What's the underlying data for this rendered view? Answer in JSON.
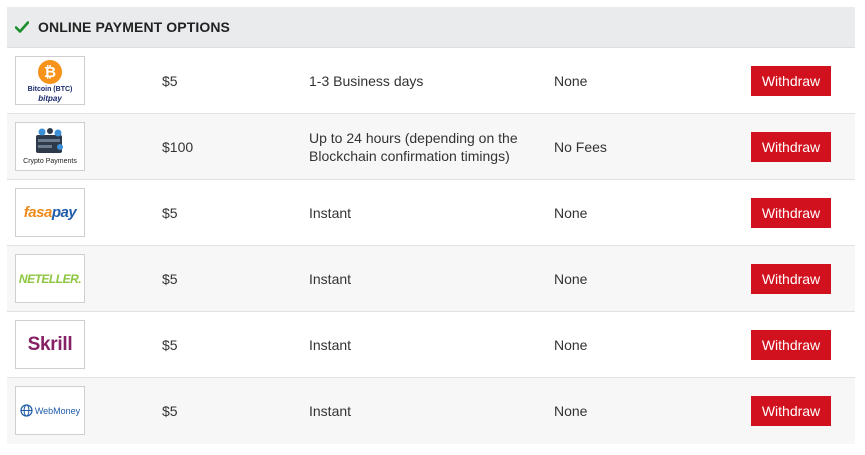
{
  "header": {
    "title": "ONLINE PAYMENT OPTIONS",
    "icon": "checkmark-icon",
    "icon_color": "#1a8f2c"
  },
  "button_color": "#d1111d",
  "methods": [
    {
      "logo": "bitcoin-bitpay",
      "logo_label": "Bitcoin (BTC)",
      "logo_sub": "bitpay",
      "min": "$5",
      "time_line1": "1-3 Business days",
      "time_line2": "",
      "fees": "None",
      "button": "Withdraw"
    },
    {
      "logo": "crypto-payments",
      "logo_label": "Crypto Payments",
      "min": "$100",
      "time_line1": "Up to 24 hours (depending on the",
      "time_line2": "Blockchain confirmation timings)",
      "fees": "No Fees",
      "button": "Withdraw"
    },
    {
      "logo": "fasapay",
      "logo_text_a": "fasa",
      "logo_text_b": "pay",
      "min": "$5",
      "time_line1": "Instant",
      "time_line2": "",
      "fees": "None",
      "button": "Withdraw"
    },
    {
      "logo": "neteller",
      "logo_text": "NETELLER.",
      "min": "$5",
      "time_line1": "Instant",
      "time_line2": "",
      "fees": "None",
      "button": "Withdraw"
    },
    {
      "logo": "skrill",
      "logo_text": "Skrill",
      "min": "$5",
      "time_line1": "Instant",
      "time_line2": "",
      "fees": "None",
      "button": "Withdraw"
    },
    {
      "logo": "webmoney",
      "logo_text": "WebMoney",
      "min": "$5",
      "time_line1": "Instant",
      "time_line2": "",
      "fees": "None",
      "button": "Withdraw"
    }
  ]
}
